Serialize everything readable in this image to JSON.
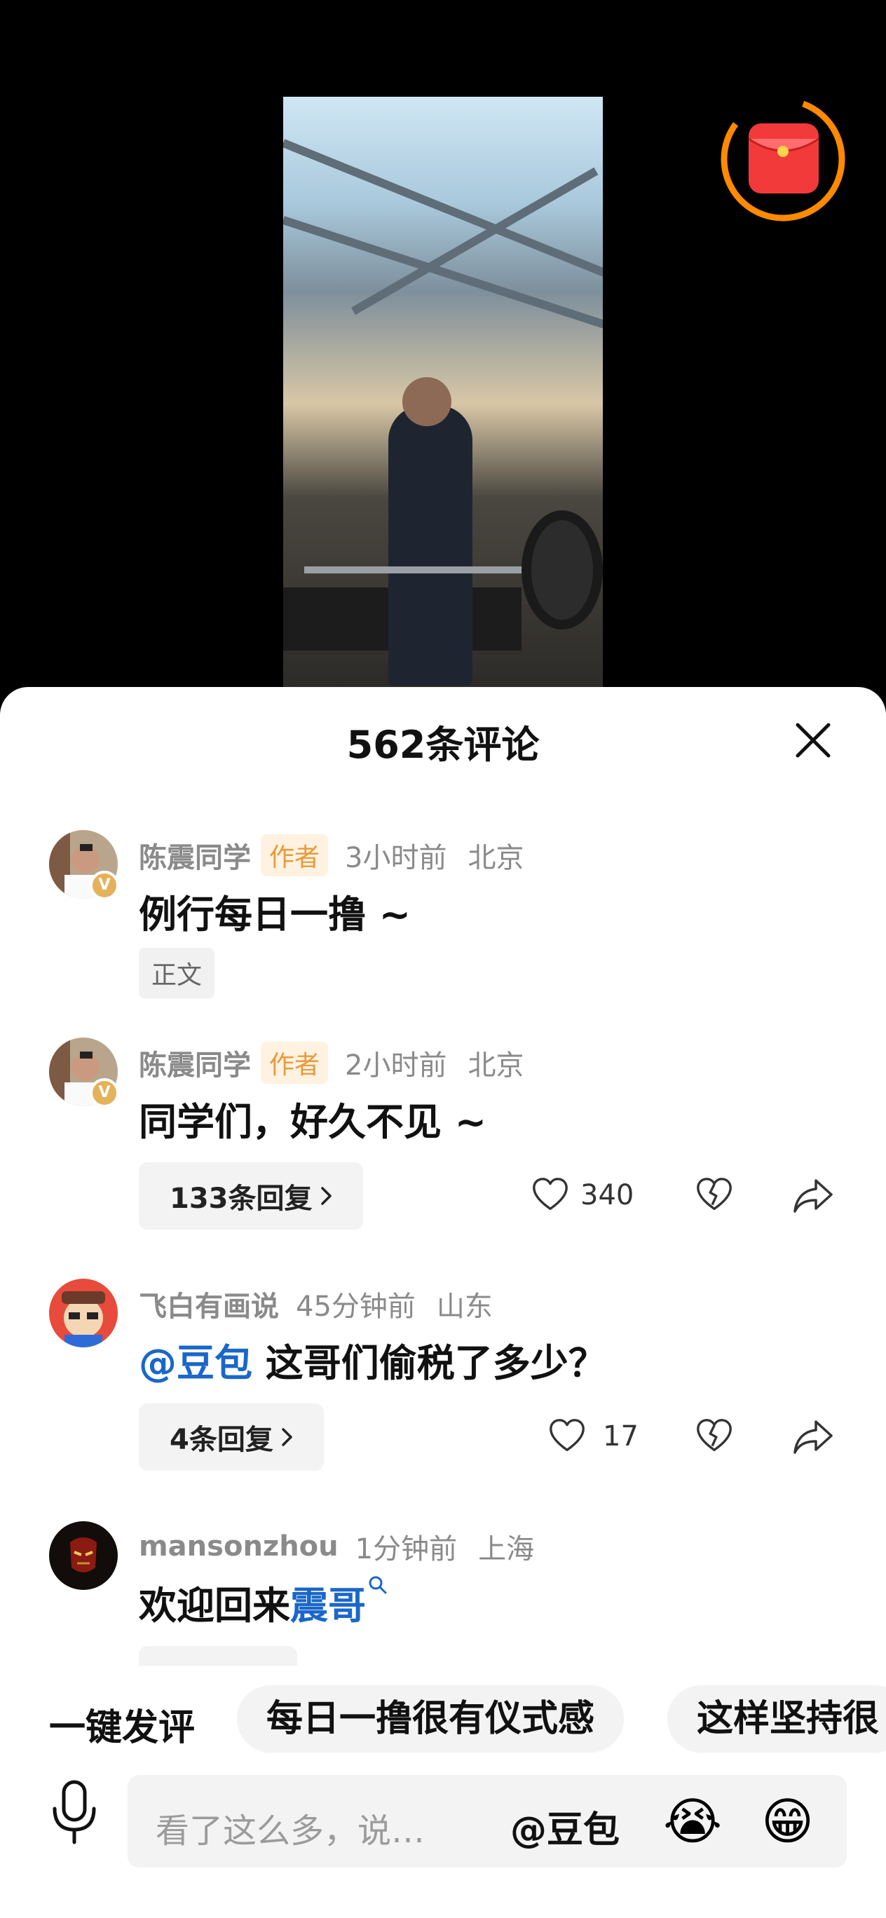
{
  "sheet": {
    "title": "562条评论"
  },
  "comments": [
    {
      "name": "陈震同学",
      "tag": "作者",
      "time": "3小时前",
      "location": "北京",
      "text": "例行每日一撸 ~",
      "label": "正文"
    },
    {
      "name": "陈震同学",
      "tag": "作者",
      "time": "2小时前",
      "location": "北京",
      "text": "同学们，好久不见 ~",
      "replies": "133条回复",
      "likes": "340"
    },
    {
      "name": "飞白有画说",
      "time": "45分钟前",
      "location": "山东",
      "mention": "@豆包",
      "text": " 这哥们偷税了多少？",
      "replies": "4条回复",
      "likes": "17"
    },
    {
      "name": "mansonzhou",
      "time": "1分钟前",
      "location": "上海",
      "text": "欢迎回来",
      "link": "震哥"
    }
  ],
  "quick": {
    "label": "一键发评",
    "chips": [
      "每日一撸很有仪式感",
      "这样坚持很"
    ]
  },
  "input": {
    "placeholder": "看了这么多，说…",
    "at": "@豆包",
    "emojis": [
      "😭",
      "😁"
    ]
  },
  "icons": {
    "badge": "V"
  }
}
